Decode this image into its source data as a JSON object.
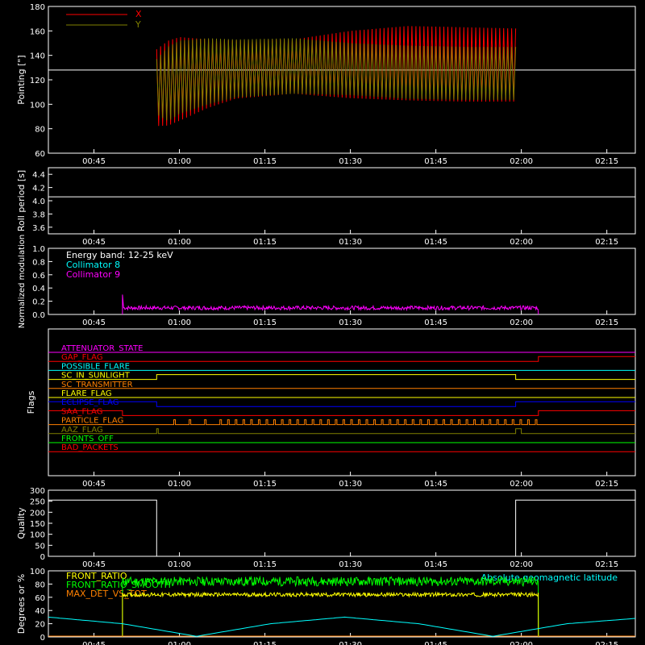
{
  "time_ticks": [
    "00:45",
    "01:00",
    "01:15",
    "01:30",
    "01:45",
    "02:00",
    "02:15"
  ],
  "time_values": [
    "00:45",
    "01:00",
    "01:15",
    "01:30",
    "01:45",
    "02:00",
    "02:15"
  ],
  "chart_data": [
    {
      "type": "area",
      "ylabel": "Pointing [\"]",
      "ylim": [
        60,
        180
      ],
      "yticks": [
        "60",
        "80",
        "100",
        "120",
        "140",
        "160",
        "180"
      ],
      "xlim": [
        "00:37",
        "02:20"
      ],
      "reference_line": 128,
      "legend_position": "top-left",
      "series": [
        {
          "name": "X",
          "color": "#ff0000",
          "x": [
            "00:56",
            "00:58",
            "01:00",
            "01:05",
            "01:10",
            "01:20",
            "01:30",
            "01:40",
            "01:50",
            "01:59"
          ],
          "upper": [
            145,
            152,
            155,
            153,
            152,
            153,
            160,
            164,
            163,
            162
          ],
          "lower": [
            80,
            80,
            84,
            95,
            103,
            107,
            103,
            101,
            100,
            100
          ]
        },
        {
          "name": "Y",
          "color": "#808000",
          "x": [
            "00:56",
            "00:58",
            "01:00",
            "01:05",
            "01:10",
            "01:20",
            "01:30",
            "01:40",
            "01:50",
            "01:59"
          ],
          "upper": [
            137,
            147,
            152,
            154,
            153,
            154,
            150,
            148,
            147,
            147
          ],
          "lower": [
            90,
            84,
            90,
            98,
            104,
            107,
            106,
            103,
            102,
            102
          ]
        }
      ]
    },
    {
      "type": "line",
      "ylabel": "Roll period [s]",
      "ylim": [
        3.5,
        4.5
      ],
      "yticks": [
        "3.6",
        "3.8",
        "4.0",
        "4.2",
        "4.4"
      ],
      "series": [
        {
          "x": [
            "00:37",
            "02:20"
          ],
          "values": [
            4.06,
            4.06
          ],
          "color": "#ffffff"
        }
      ]
    },
    {
      "type": "line",
      "ylabel": "Normalized modulation",
      "ylim": [
        0,
        1
      ],
      "yticks": [
        "0.0",
        "0.2",
        "0.4",
        "0.6",
        "0.8",
        "1.0"
      ],
      "annotations": [
        "Energy band: 12-25 keV"
      ],
      "legend_position": "top-left",
      "series": [
        {
          "name": "Collimator 8",
          "color": "#00ffff",
          "x": [],
          "values": []
        },
        {
          "name": "Collimator 9",
          "color": "#ff00ff",
          "x": [
            "00:50",
            "02:03"
          ],
          "mean": 0.1,
          "spread": 0.03,
          "start_spike": 0.3
        }
      ]
    },
    {
      "type": "table",
      "ylabel": "Flags",
      "flags": [
        {
          "name": "ATTENUATOR_STATE",
          "color": "#ff00ff",
          "segments": []
        },
        {
          "name": "GAP_FLAG",
          "color": "#ff0000",
          "segments": [
            [
              "02:03",
              "02:20"
            ]
          ]
        },
        {
          "name": "POSSIBLE_FLARE",
          "color": "#00ffff",
          "segments": []
        },
        {
          "name": "SC_IN_SUNLIGHT",
          "color": "#ffff00",
          "segments": [
            [
              "00:56",
              "01:59"
            ]
          ]
        },
        {
          "name": "SC_TRANSMITTER",
          "color": "#ff8000",
          "segments": []
        },
        {
          "name": "FLARE_FLAG",
          "color": "#ffff00",
          "segments": []
        },
        {
          "name": "ECLIPSE_FLAG",
          "color": "#0000ff",
          "segments": [
            [
              "00:37",
              "00:56"
            ],
            [
              "01:59",
              "02:20"
            ]
          ]
        },
        {
          "name": "SAA_FLAG",
          "color": "#ff0000",
          "segments": [
            [
              "00:37",
              "00:50"
            ],
            [
              "02:03",
              "02:20"
            ]
          ]
        },
        {
          "name": "PARTICLE_FLAG",
          "color": "#ff8000",
          "segments": []
        },
        {
          "name": "AAZ_FLAG",
          "color": "#808000",
          "segments": [
            [
              "00:56",
              "00:56"
            ],
            [
              "01:59",
              "02:00"
            ]
          ]
        },
        {
          "name": "FRONTS_OFF",
          "color": "#00ff00",
          "segments": []
        },
        {
          "name": "BAD_PACKETS",
          "color": "#ff0000",
          "segments": []
        }
      ]
    },
    {
      "type": "line",
      "ylabel": "Quality",
      "ylim": [
        0,
        300
      ],
      "yticks": [
        "0",
        "50",
        "100",
        "150",
        "200",
        "250",
        "300"
      ],
      "series": [
        {
          "color": "#ffffff",
          "x": [
            "00:37",
            "00:56",
            "00:56",
            "01:59",
            "01:59",
            "02:20"
          ],
          "values": [
            255,
            255,
            0,
            0,
            255,
            255
          ]
        }
      ]
    },
    {
      "type": "line",
      "ylabel": "Degrees or %",
      "ylim": [
        0,
        100
      ],
      "yticks": [
        "0",
        "20",
        "40",
        "60",
        "80",
        "100"
      ],
      "series": [
        {
          "name": "FRONT_RATIO",
          "color": "#ffff00",
          "x": [
            "00:50",
            "02:03"
          ],
          "mean": 64,
          "spread": 3
        },
        {
          "name": "FRONT_RATIO_SMOOTH",
          "color": "#00ff00",
          "x": [
            "00:50",
            "02:03"
          ],
          "mean": 84,
          "spread": 7
        },
        {
          "name": "MAX_DET_VS_TOT",
          "color": "#ff8000",
          "x": [
            "00:37",
            "02:20"
          ],
          "values": [
            0,
            0
          ]
        },
        {
          "name": "Absolute geomagnetic latitude",
          "color": "#00ffff",
          "x": [
            "00:37",
            "00:50",
            "01:03",
            "01:16",
            "01:29",
            "01:42",
            "01:55",
            "02:08",
            "02:20"
          ],
          "values": [
            30,
            20,
            1,
            20,
            30,
            20,
            1,
            20,
            28
          ]
        }
      ]
    }
  ]
}
